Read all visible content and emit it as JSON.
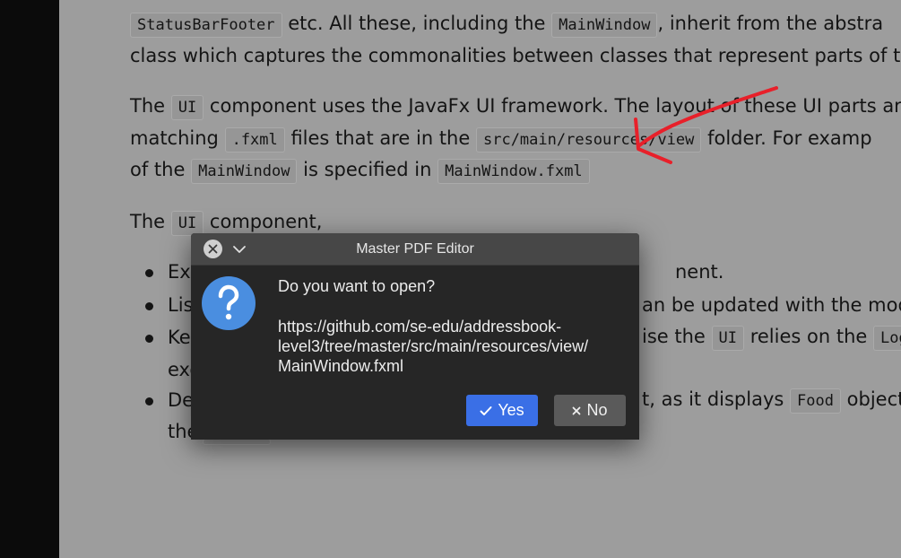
{
  "document": {
    "line1": {
      "code1": "StatusBarFooter",
      "text1": "etc. All these, including the",
      "code2": "MainWindow",
      "text2": ", inherit from the abstra"
    },
    "line2": "class which captures the commonalities between classes that represent parts of the vi",
    "line3": {
      "text1": "The",
      "code1": "UI",
      "text2": "component uses the JavaFx UI framework. The layout of these UI parts are d"
    },
    "line4": {
      "text1": "matching",
      "code1": ".fxml",
      "text2": "files that are in the",
      "code2": "src/main/resources/view",
      "text3": "folder. For examp"
    },
    "line5": {
      "text1": "of the",
      "code1": "MainWindow",
      "text2": "is specified in",
      "code2": "MainWindow.fxml"
    },
    "line6": {
      "text1": "The",
      "code1": "UI",
      "text2": "component,"
    },
    "bullet1": {
      "start": "Exe",
      "end": "nent."
    },
    "bullet2": {
      "start": "Lis",
      "end": "an be updated with the modi"
    },
    "bullet3": {
      "start": "Ke",
      "end1": "ise the",
      "code1": "UI",
      "end2": "relies on the",
      "code2": "Log"
    },
    "bullet3b": "exe",
    "bullet4": {
      "start": "De",
      "end1": "t, as it displays",
      "code1": "Food",
      "end2": "object"
    },
    "bullet4b": "the"
  },
  "dialog": {
    "title": "Master PDF Editor",
    "question": "Do you want to open?",
    "url_line1": "https://github.com/se-edu/addressbook-",
    "url_line2": "level3/tree/master/src/main/resources/view/",
    "url_line3": "MainWindow.fxml",
    "yes_label": "Yes",
    "no_label": "No",
    "icons": {
      "close": "close-icon",
      "menu": "chevron-down-icon",
      "question": "question-icon",
      "yes": "check-icon",
      "no": "x-icon"
    }
  },
  "colors": {
    "accent": "#3a6fe6",
    "question_icon": "#4a8ee0",
    "annotation": "#e8202a",
    "dialog_bg": "#262626"
  }
}
